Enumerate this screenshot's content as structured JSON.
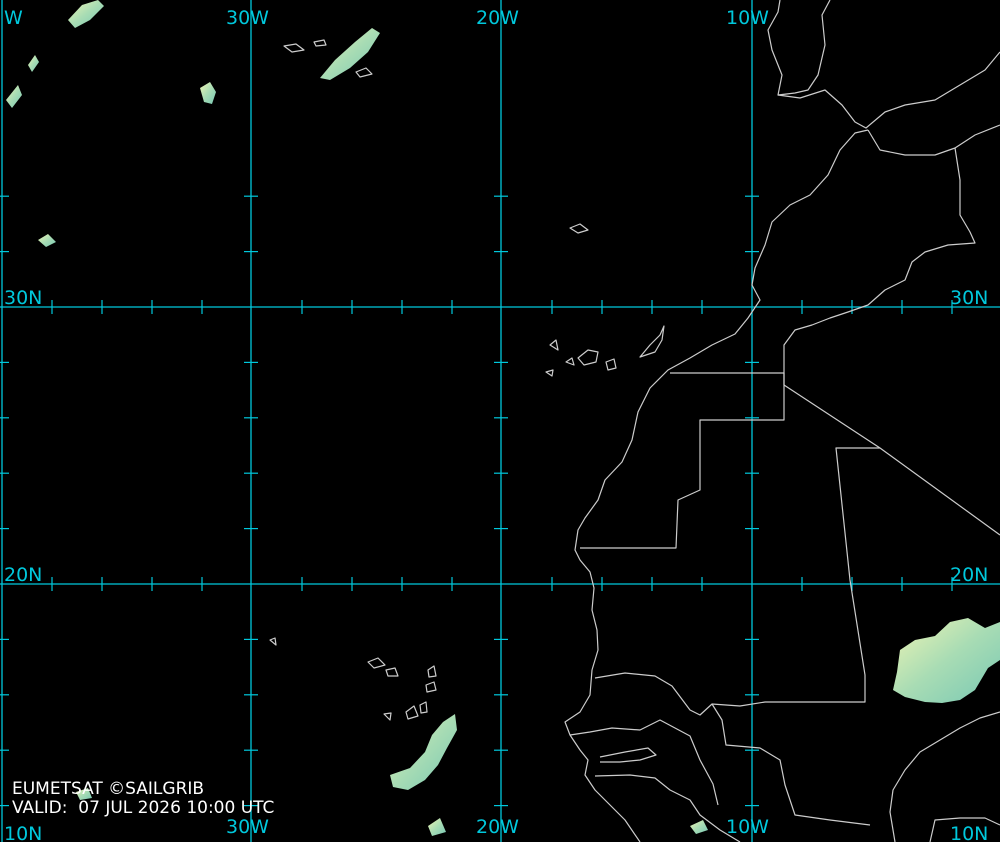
{
  "map": {
    "longitude_labels": [
      "30W",
      "20W",
      "10W"
    ],
    "longitude_labels_partial": [
      "W"
    ],
    "latitude_labels": [
      "30N",
      "20N"
    ],
    "bottom_labels": [
      "30W",
      "20W",
      "10W",
      "10N"
    ],
    "bottom_left_label": "10N",
    "colors": {
      "background": "#000000",
      "graticule": "#00c8dc",
      "coastline": "#cccccc",
      "cloud_low": "#f0f5b4",
      "cloud_high": "#78c8b4"
    }
  },
  "credit": {
    "line1": "EUMETSAT ©SAILGRIB",
    "line2": "VALID:  07 JUL 2026 10:00 UTC"
  }
}
